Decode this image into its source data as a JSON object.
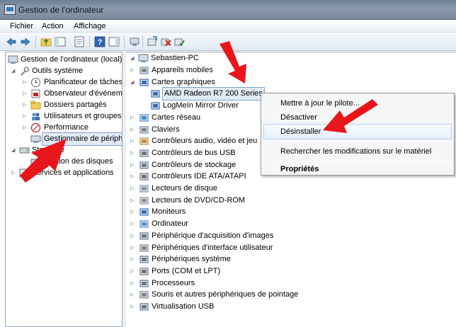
{
  "window": {
    "title": "Gestion de l'ordinateur"
  },
  "menu": {
    "file": "Fichier",
    "action": "Action",
    "view": "Affichage"
  },
  "toolbar": {
    "back_icon": "arrow-left-icon",
    "forward_icon": "arrow-right-icon",
    "up_icon": "folder-up-icon",
    "console_icon": "console-tree-icon",
    "properties_icon": "properties-icon",
    "help_icon": "help-icon",
    "action_pane_icon": "action-pane-icon",
    "scan_icon": "scan-hardware-icon",
    "update_icon": "update-driver-icon",
    "uninstall_icon": "uninstall-icon",
    "enable_icon": "enable-icon"
  },
  "left_tree": {
    "root": "Gestion de l'ordinateur (local)",
    "system_tools": "Outils système",
    "task_scheduler": "Planificateur de tâches",
    "event_viewer": "Observateur d'événeme",
    "shared_folders": "Dossiers partagés",
    "users_groups": "Utilisateurs et groupes l",
    "performance": "Performance",
    "device_manager": "Gestionnaire de périphé",
    "storage": "Stockage",
    "disk_management": "Gestion des disques",
    "services_apps": "Services et applications"
  },
  "right_tree": {
    "computer": "Sebastien-PC",
    "categories": [
      "Appareils mobiles",
      "Cartes graphiques",
      "AMD Radeon R7 200 Series",
      "LogMeIn Mirror Driver",
      "Cartes réseau",
      "Claviers",
      "Contrôleurs audio, vidéo et jeu",
      "Contrôleurs de bus USB",
      "Contrôleurs de stockage",
      "Contrôleurs IDE ATA/ATAPI",
      "Lecteurs de disque",
      "Lecteurs de DVD/CD-ROM",
      "Moniteurs",
      "Ordinateur",
      "Périphérique d'acquisition d'images",
      "Périphériques d'interface utilisateur",
      "Périphériques système",
      "Ports (COM et LPT)",
      "Processeurs",
      "Souris et autres périphériques de pointage",
      "Virtualisation USB"
    ]
  },
  "context_menu": {
    "update_driver": "Mettre à jour le pilote...",
    "disable": "Désactiver",
    "uninstall": "Désinstaller",
    "scan_changes": "Rechercher les modifications sur le matériel",
    "properties": "Propriétés"
  },
  "colors": {
    "arrow": "#e8161b",
    "selection": "#e2eaf6",
    "menu_hover": "#e6f0fb"
  }
}
